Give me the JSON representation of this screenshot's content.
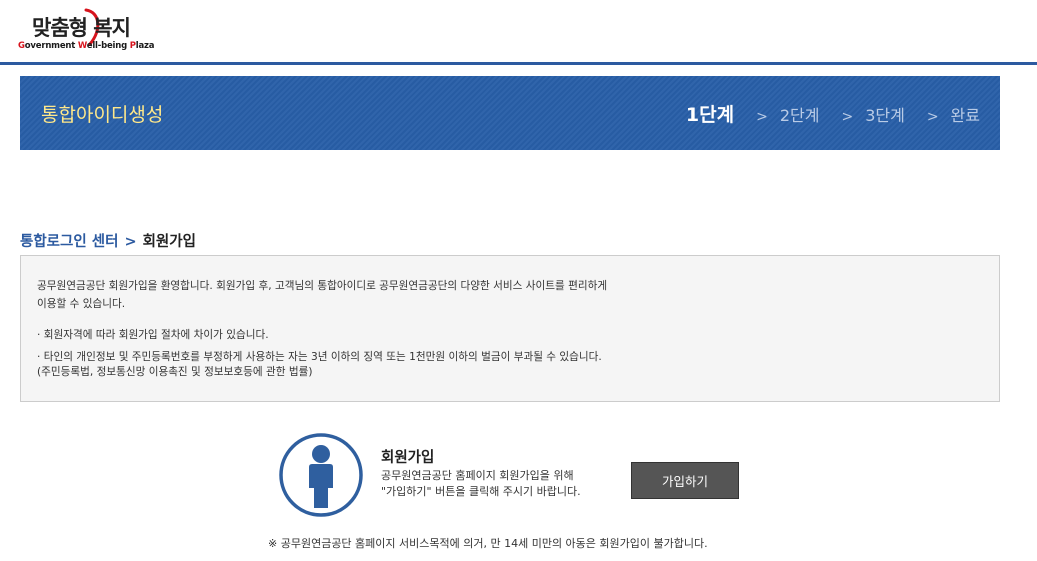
{
  "logo": {
    "title": "맞춤형 복지",
    "subtitle": "Government Well-being Plaza"
  },
  "banner": {
    "title": "통합아이디생성",
    "steps": [
      "1단계",
      "2단계",
      "3단계",
      "완료"
    ],
    "separator": ">"
  },
  "breadcrumb": {
    "parent": "통합로그인 센터",
    "separator": ">",
    "current": "회원가입"
  },
  "notice": {
    "line1": "공무원연금공단 회원가입을 환영합니다. 회원가입 후, 고객님의 통합아이디로 공무원연금공단의 다양한 서비스 사이트를 편리하게",
    "line2": "이용할 수 있습니다.",
    "bullet1": "· 회원자격에 따라 회원가입 절차에 차이가 있습니다.",
    "bullet2": "· 타인의 개인정보 및 주민등록번호를 부정하게 사용하는 자는 3년 이하의 징역 또는 1천만원 이하의 벌금이 부과될 수 있습니다.",
    "bullet2_note": "(주민등록법, 정보통신망 이용촉진 및 정보보호등에 관한 법률)"
  },
  "join": {
    "title": "회원가입",
    "desc_line1": "공무원연금공단 홈페이지 회원가입을 위해",
    "desc_line2": "\"가입하기\" 버튼을 클릭해 주시기 바랍니다.",
    "button_label": "가입하기"
  },
  "footnote": "※ 공무원연금공단 홈페이지 서비스목적에 의거, 만 14세 미만의 아동은 회원가입이 불가합니다.",
  "colors": {
    "brand_blue": "#285fa8",
    "banner_title": "#ffe88a",
    "button": "#555555"
  }
}
